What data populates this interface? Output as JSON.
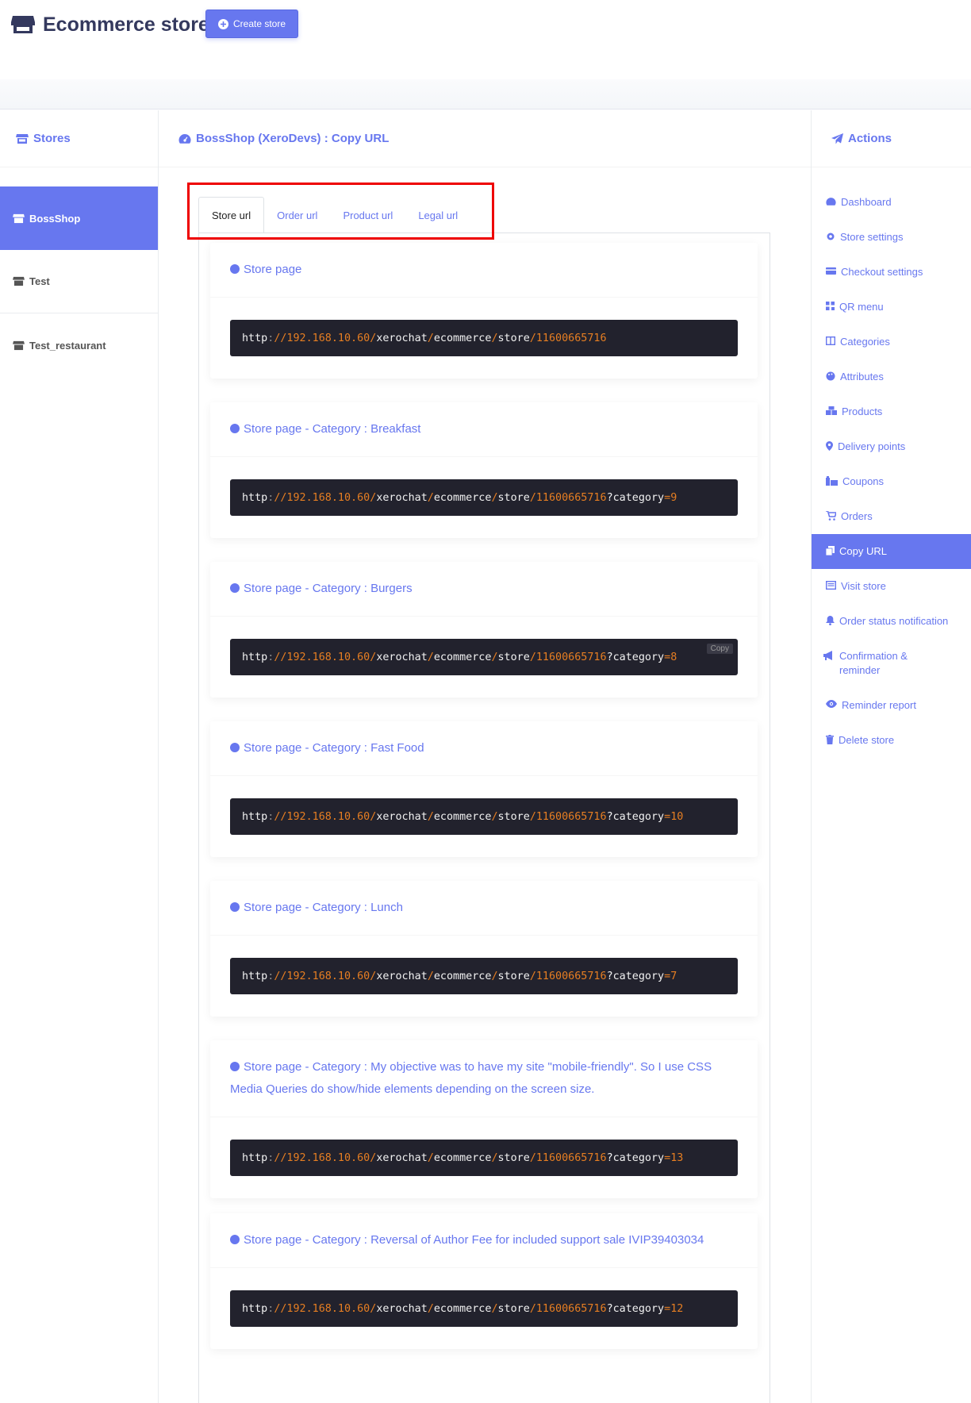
{
  "header": {
    "title": "Ecommerce store",
    "create_button": "Create store"
  },
  "stores_panel": {
    "title": "Stores",
    "items": [
      {
        "label": "BossShop",
        "active": true
      },
      {
        "label": "Test",
        "active": false
      },
      {
        "label": "Test_restaurant",
        "active": false
      }
    ]
  },
  "main": {
    "title": "BossShop (XeroDevs) : Copy URL",
    "tabs": [
      {
        "label": "Store url",
        "active": true
      },
      {
        "label": "Order url",
        "active": false
      },
      {
        "label": "Product url",
        "active": false
      },
      {
        "label": "Legal url",
        "active": false
      }
    ],
    "copy_label": "Copy",
    "url_parts": {
      "scheme": "http",
      "colon": ":",
      "host": "//192.168.10.60",
      "slash": "/",
      "app": "xerochat",
      "module": "ecommerce",
      "section": "store",
      "store_id": "11600665716",
      "query_key": "?category",
      "equals": "="
    },
    "cards": [
      {
        "title": "Store page",
        "category_id": ""
      },
      {
        "title": "Store page - Category : Breakfast",
        "category_id": "9"
      },
      {
        "title": "Store page - Category : Burgers",
        "category_id": "8"
      },
      {
        "title": "Store page - Category : Fast Food",
        "category_id": "10"
      },
      {
        "title": "Store page - Category : Lunch",
        "category_id": "7"
      },
      {
        "title": "Store page - Category : My objective was to have my site \"mobile-friendly\". So I use CSS Media Queries do show/hide elements depending on the screen size.",
        "category_id": "13"
      },
      {
        "title": "Store page - Category : Reversal of Author Fee for included support sale IVIP39403034",
        "category_id": "12"
      }
    ]
  },
  "actions_panel": {
    "title": "Actions",
    "items": [
      {
        "label": "Dashboard",
        "icon": "dashboard-icon"
      },
      {
        "label": "Store settings",
        "icon": "gear-icon"
      },
      {
        "label": "Checkout settings",
        "icon": "credit-card-icon"
      },
      {
        "label": "QR menu",
        "icon": "qrcode-icon"
      },
      {
        "label": "Categories",
        "icon": "columns-icon"
      },
      {
        "label": "Attributes",
        "icon": "palette-icon"
      },
      {
        "label": "Products",
        "icon": "boxes-icon"
      },
      {
        "label": "Delivery points",
        "icon": "map-marker-icon"
      },
      {
        "label": "Coupons",
        "icon": "coupon-icon"
      },
      {
        "label": "Orders",
        "icon": "cart-icon"
      },
      {
        "label": "Copy URL",
        "icon": "copy-icon",
        "active": true
      },
      {
        "label": "Visit store",
        "icon": "visit-icon"
      },
      {
        "label": "Order status notification",
        "icon": "bell-icon"
      },
      {
        "label": "Confirmation & reminder",
        "icon": "bullhorn-icon"
      },
      {
        "label": "Reminder report",
        "icon": "eye-icon"
      },
      {
        "label": "Delete store",
        "icon": "trash-icon"
      }
    ]
  },
  "colors": {
    "accent": "#6777ef",
    "code_bg": "#22222d",
    "code_orange": "#e67e22",
    "highlight_red": "#ee0000"
  }
}
